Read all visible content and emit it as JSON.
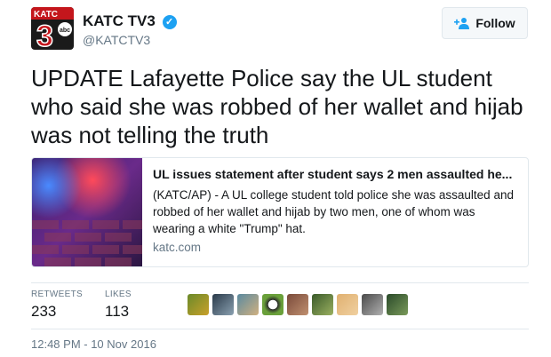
{
  "account": {
    "name": "KATC TV3",
    "handle": "@KATCTV3",
    "logo_text": "KATC",
    "logo_number": "3",
    "logo_network": "abc"
  },
  "follow_button": {
    "label": "Follow"
  },
  "tweet": {
    "text": "UPDATE Lafayette Police say the UL student who said she was robbed of her wallet and hijab was not telling the truth"
  },
  "card": {
    "title": "UL issues statement after student says 2 men assaulted he...",
    "description": "(KATC/AP) - A UL college student told police she was assaulted and robbed of her wallet and hijab by two men, one of whom was wearing a white \"Trump\" hat.",
    "domain": "katc.com"
  },
  "stats": {
    "retweets_label": "RETWEETS",
    "retweets_value": "233",
    "likes_label": "LIKES",
    "likes_value": "113"
  },
  "likers": [
    "liker-1",
    "liker-2",
    "liker-3",
    "liker-4",
    "liker-5",
    "liker-6",
    "liker-7",
    "liker-8",
    "liker-9"
  ],
  "timestamp": "12:48 PM - 10 Nov 2016",
  "colors": {
    "verified": "#1da1f2",
    "text": "#14171a",
    "muted": "#657786",
    "border": "#e1e8ed"
  }
}
